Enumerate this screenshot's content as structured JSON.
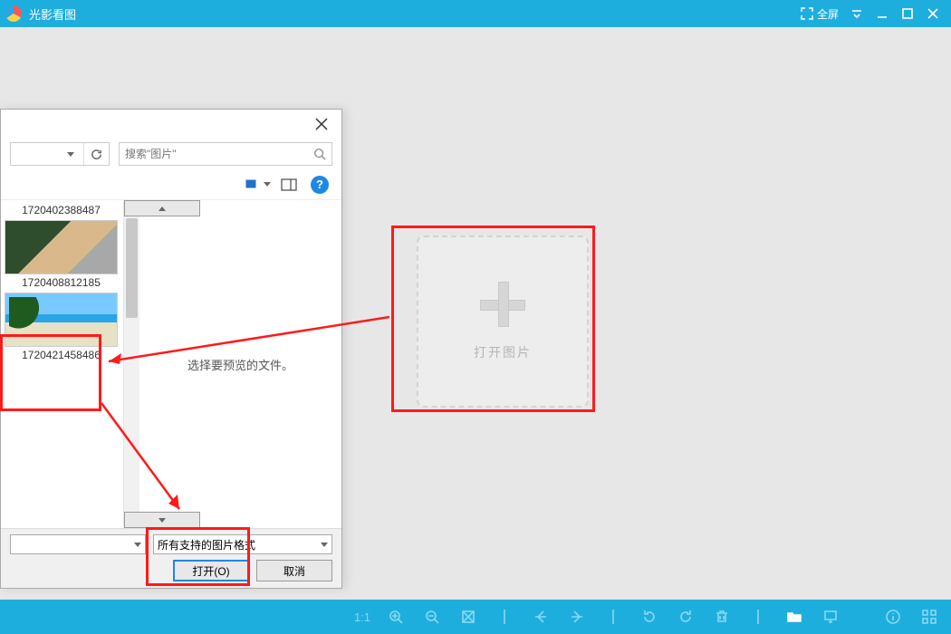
{
  "app": {
    "title": "光影看图"
  },
  "titlebar": {
    "fullscreen": "全屏"
  },
  "dropzone": {
    "label": "打开图片"
  },
  "dialog": {
    "search_placeholder": "搜索\"图片\"",
    "preview_hint": "选择要预览的文件。",
    "thumbs": [
      {
        "name": "1720402388487"
      },
      {
        "name": "1720408812185"
      },
      {
        "name": "1720421458486"
      }
    ],
    "filter_label": "所有支持的图片格式",
    "open_label": "打开(O)",
    "cancel_label": "取消"
  },
  "toolbar": {
    "ratio": "1:1"
  }
}
